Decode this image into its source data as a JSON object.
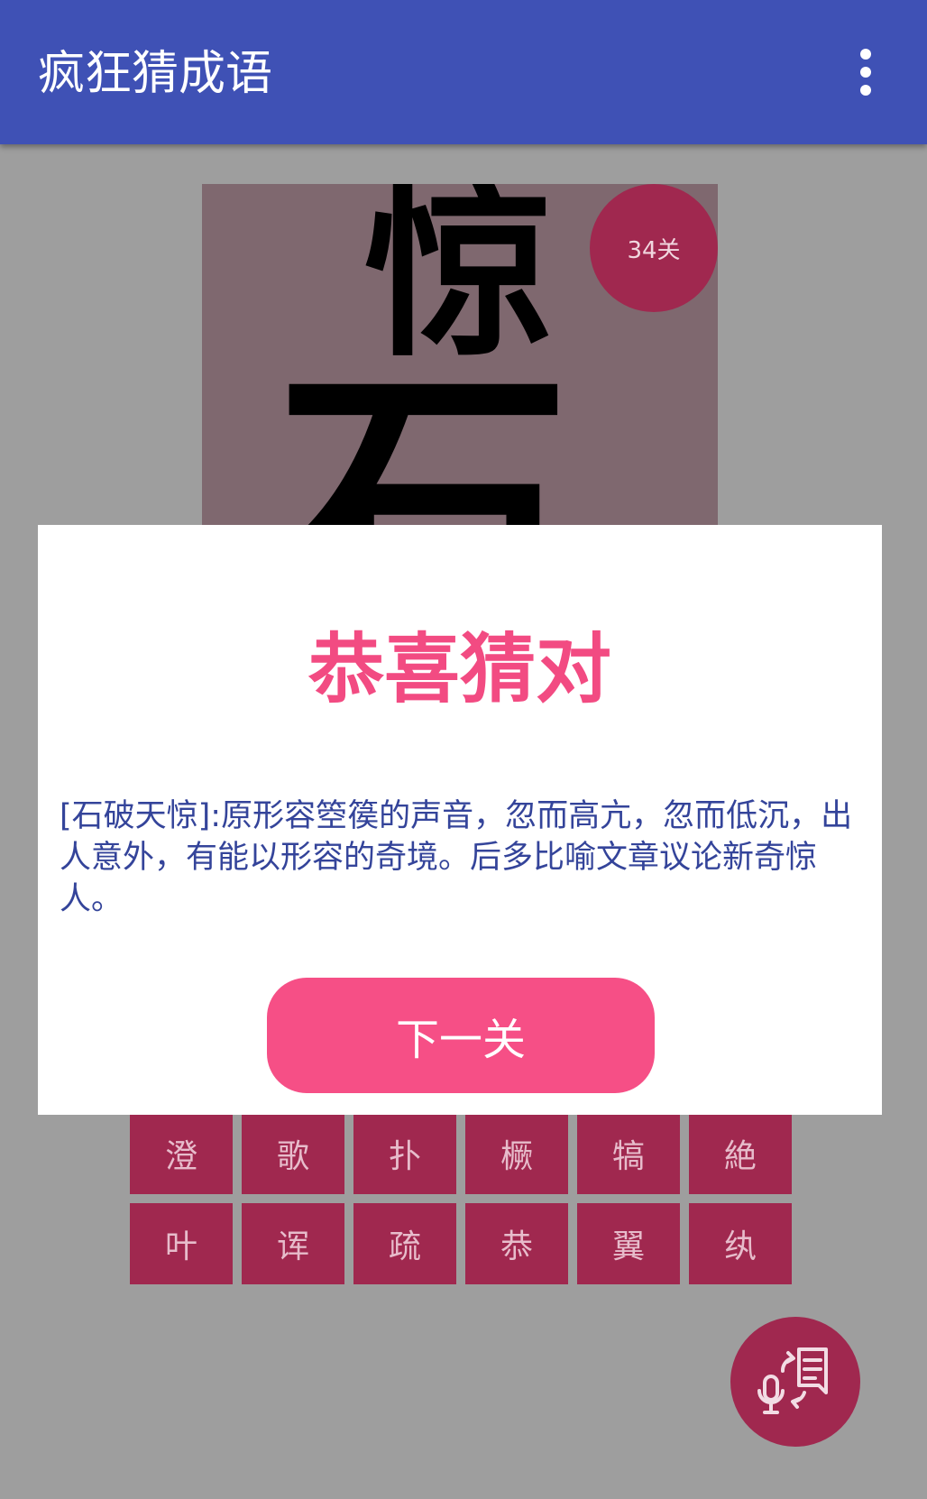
{
  "app": {
    "title": "疯狂猜成语",
    "menu_icon": "more-vert-icon"
  },
  "puzzle": {
    "visible_chars": [
      "惊",
      "石"
    ],
    "level_badge": "34关"
  },
  "dialog": {
    "heading": "恭喜猜对",
    "explanation": "[石破天惊]:原形容箜篌的声音，忽而高亢，忽而低沉，出人意外，有能以形容的奇境。后多比喻文章议论新奇惊人。",
    "next_button": "下一关"
  },
  "char_grid": {
    "rows": [
      [
        "澄",
        "歌",
        "扑",
        "橛",
        "犒",
        "絶"
      ],
      [
        "叶",
        "诨",
        "疏",
        "恭",
        "翼",
        "纨"
      ]
    ]
  },
  "fab": {
    "icon": "voice-to-text-icon"
  },
  "colors": {
    "appbar": "#3f51b5",
    "accent": "#a0284f",
    "heading": "#f24b82",
    "button": "#f64f86",
    "body_text": "#34449a",
    "backdrop": "#9e9e9e"
  }
}
